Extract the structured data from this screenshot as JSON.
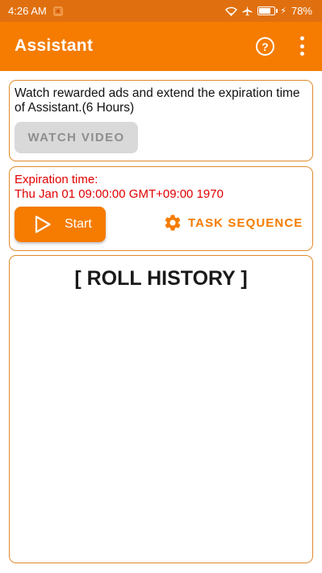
{
  "status_bar": {
    "time": "4:26 AM",
    "battery_percent": "78%",
    "battery_level": 0.78
  },
  "app_bar": {
    "title": "Assistant",
    "icons": [
      "help-icon",
      "more-vert-icon"
    ]
  },
  "ads_card": {
    "description": "Watch rewarded ads and extend the expiration time of Assistant.(6 Hours)",
    "watch_button_label": "WATCH VIDEO"
  },
  "expiration_card": {
    "label": "Expiration time:",
    "value": "Thu Jan 01 09:00:00 GMT+09:00 1970",
    "start_button_label": "Start",
    "task_sequence_label": "TASK SEQUENCE"
  },
  "roll_history": {
    "title": "[ ROLL HISTORY ]"
  },
  "colors": {
    "status_bar": "#e0700f",
    "app_bar": "#f57c00",
    "accent": "#f57c00",
    "error_text": "#e00000",
    "card_border": "#e08a2c",
    "disabled_button": "#d9d9d9"
  }
}
